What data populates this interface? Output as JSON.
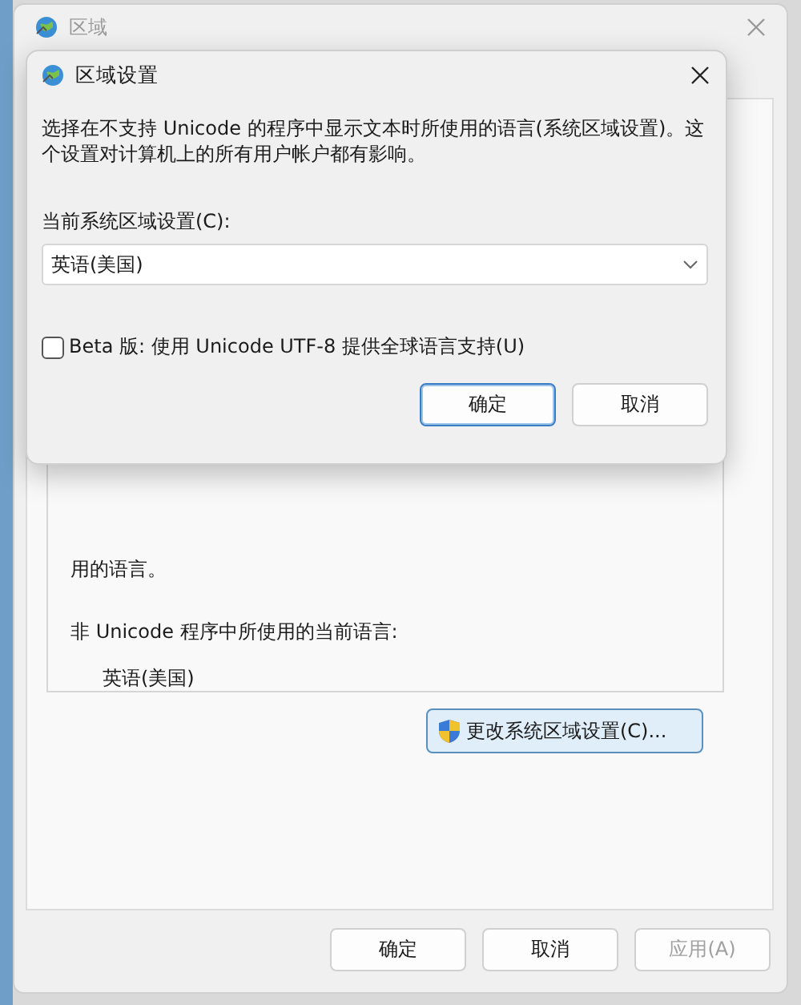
{
  "window": {
    "title": "区域"
  },
  "panel": {
    "cut_text": "用的语言。",
    "current_label": "非 Unicode 程序中所使用的当前语言:",
    "current_value": "英语(美国)",
    "change_button": "更改系统区域设置(C)..."
  },
  "buttons": [
    {
      "label": "确定",
      "disabled": false
    },
    {
      "label": "取消",
      "disabled": false
    },
    {
      "label": "应用(A)",
      "disabled": true
    }
  ],
  "dialog": {
    "title": "区域设置",
    "description": "选择在不支持 Unicode 的程序中显示文本时所使用的语言(系统区域设置)。这个设置对计算机上的所有用户帐户都有影响。",
    "locale_label": "当前系统区域设置(C):",
    "locale_value": "英语(美国)",
    "beta": {
      "label": "Beta 版: 使用 Unicode UTF-8 提供全球语言支持(U)",
      "checked": false
    },
    "buttons": [
      {
        "label": "确定",
        "default": true
      },
      {
        "label": "取消",
        "default": false
      }
    ]
  }
}
